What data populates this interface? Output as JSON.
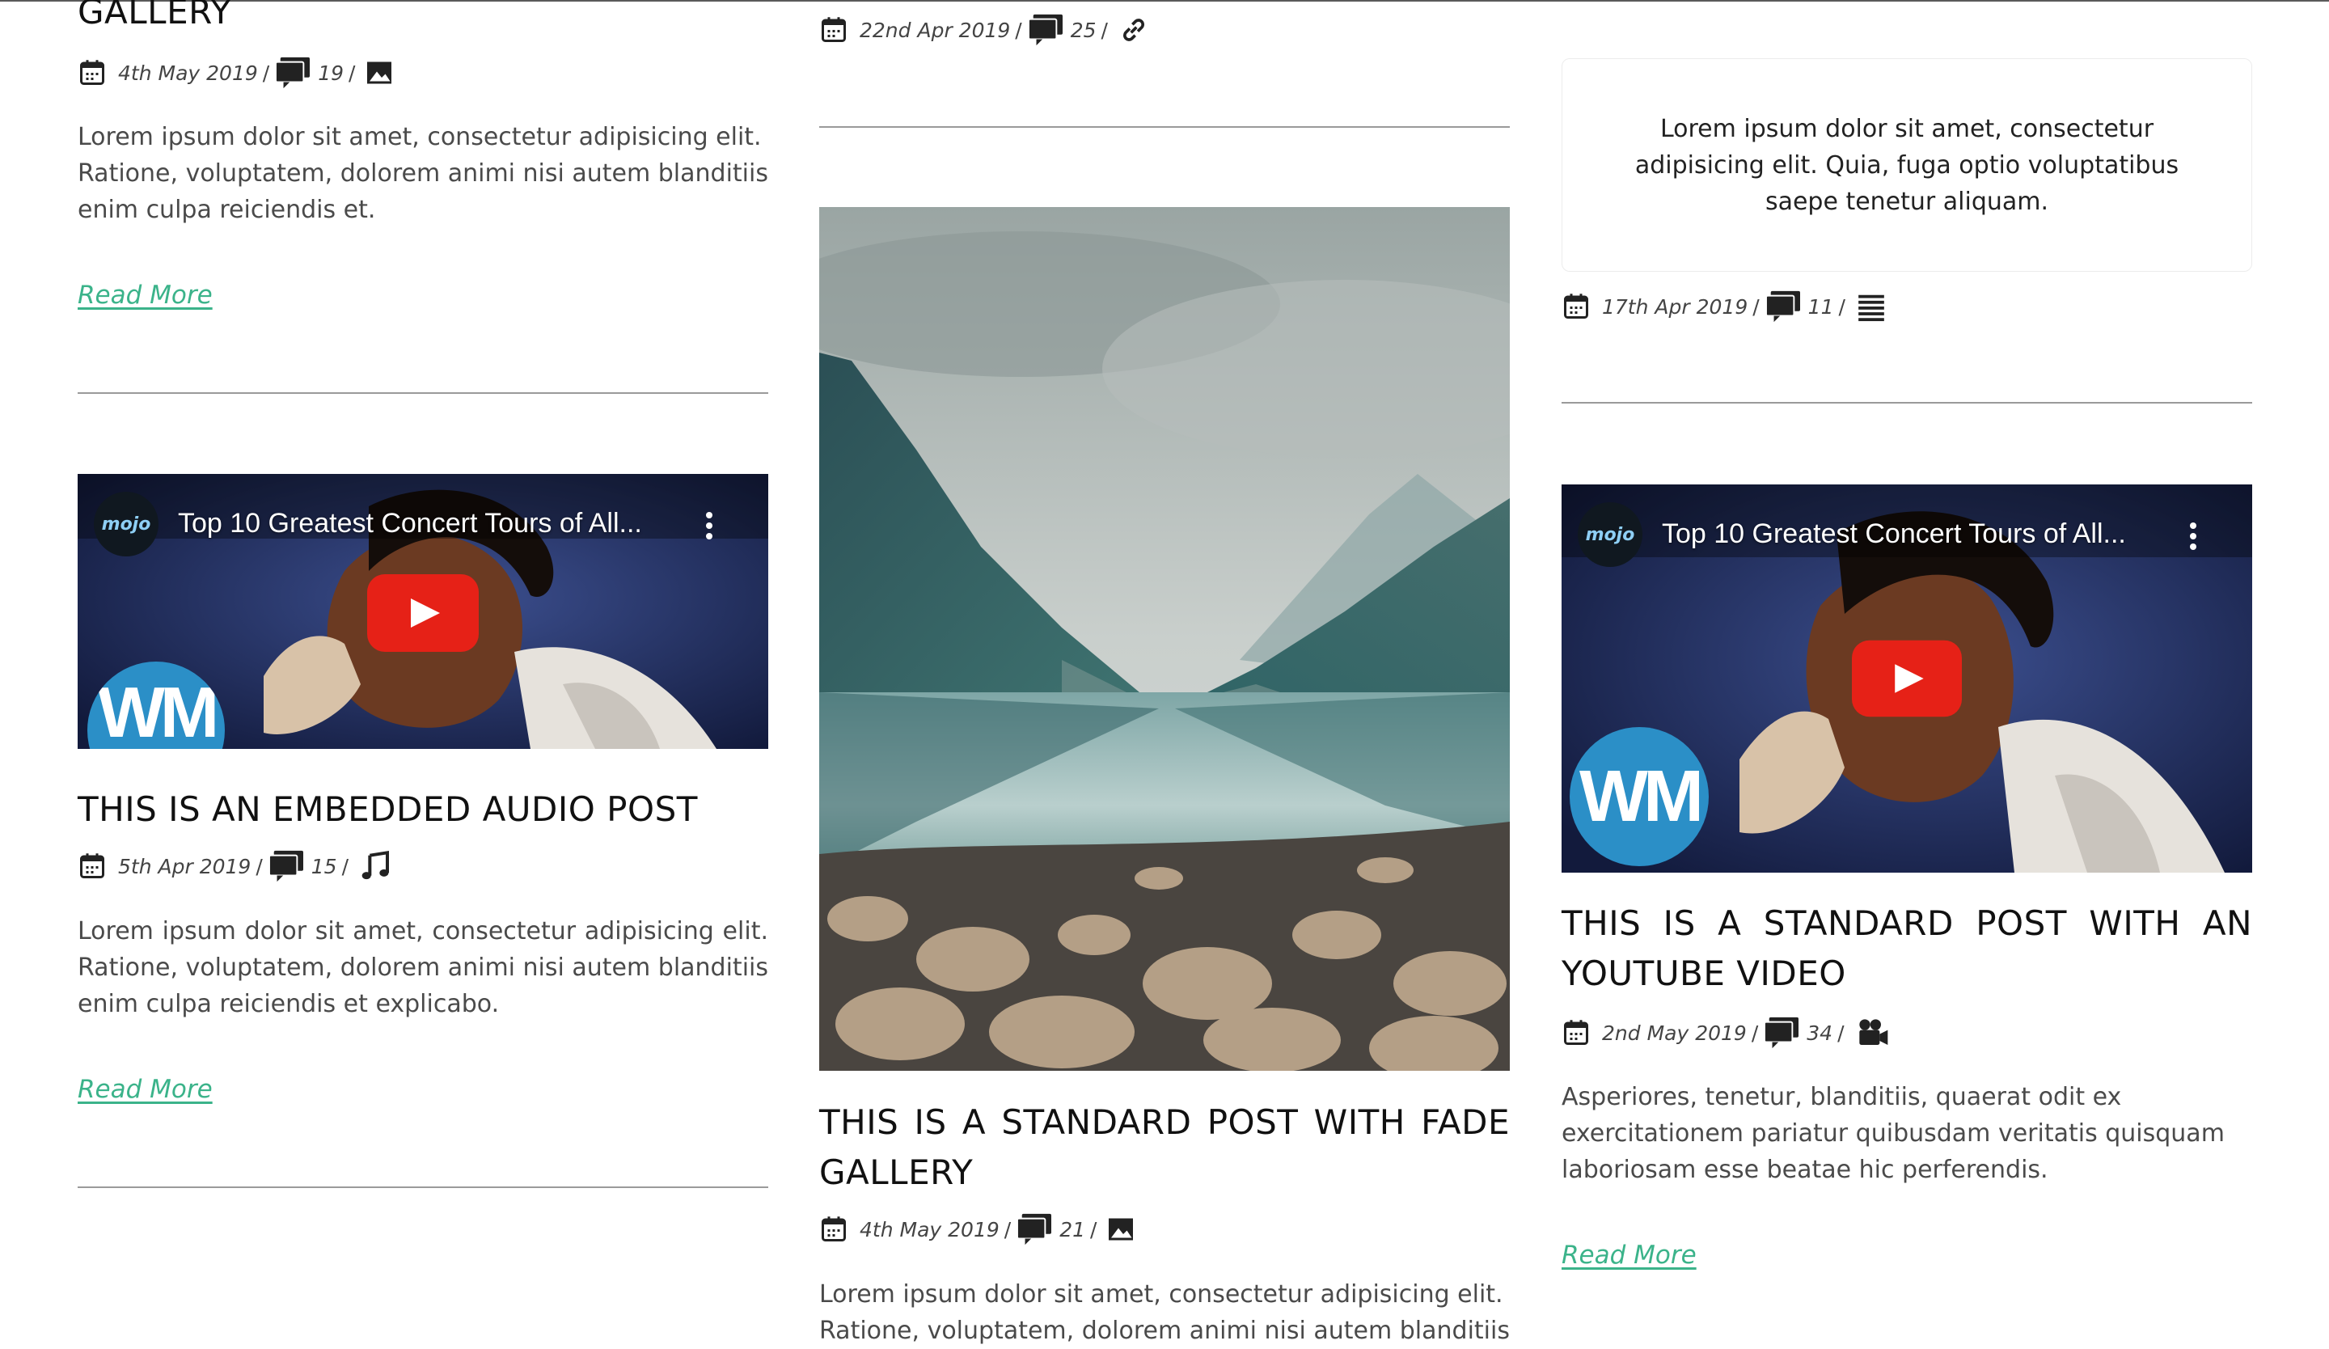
{
  "posts": {
    "gallery_top": {
      "title": "GALLERY",
      "date": "4th May 2019",
      "comments": "19",
      "format_icon": "image-icon",
      "excerpt": "Lorem ipsum dolor sit amet, consectetur adipisicing elit. Ratione, voluptatem, dolorem animi nisi autem blanditiis enim culpa reiciendis et.",
      "read_more": "Read More"
    },
    "audio": {
      "video_title": "Top 10 Greatest Concert Tours of All...",
      "channel": "mojo",
      "watermark": "WM",
      "title": "THIS IS AN EMBEDDED AUDIO POST",
      "date": "5th Apr 2019",
      "comments": "15",
      "format_icon": "music-note-icon",
      "excerpt": "Lorem ipsum dolor sit amet, consectetur adipisicing elit. Ratione, voluptatem, dolorem animi nisi autem blanditiis enim culpa reiciendis et explicabo.",
      "read_more": "Read More"
    },
    "link": {
      "date": "22nd Apr 2019",
      "comments": "25",
      "format_icon": "link-icon"
    },
    "fade_gallery": {
      "title": "THIS IS A STANDARD POST WITH FADE GALLERY",
      "date": "4th May 2019",
      "comments": "21",
      "format_icon": "image-icon",
      "excerpt": "Lorem ipsum dolor sit amet, consectetur adipisicing elit. Ratione, voluptatem, dolorem animi nisi autem blanditiis"
    },
    "quote": {
      "text": "Lorem ipsum dolor sit amet, consectetur adipisicing elit. Quia, fuga optio voluptatibus saepe tenetur aliquam.",
      "date": "17th Apr 2019",
      "comments": "11",
      "format_icon": "text-lines-icon"
    },
    "youtube": {
      "video_title": "Top 10 Greatest Concert Tours of All...",
      "channel": "mojo",
      "watermark": "WM",
      "title": "THIS IS A STANDARD POST WITH AN YOUTUBE VIDEO",
      "date": "2nd May 2019",
      "comments": "34",
      "format_icon": "video-camera-icon",
      "excerpt": "Asperiores, tenetur, blanditiis, quaerat odit ex exercitationem pariatur quibusdam veritatis quisquam laboriosam esse beatae hic perferendis.",
      "read_more": "Read More"
    }
  },
  "meta": {
    "separator": "/"
  },
  "colors": {
    "accent": "#3bb38a",
    "rule": "#9a9a9a",
    "text": "#4a4a4a",
    "heading": "#111111",
    "youtube_red": "#e62117"
  }
}
